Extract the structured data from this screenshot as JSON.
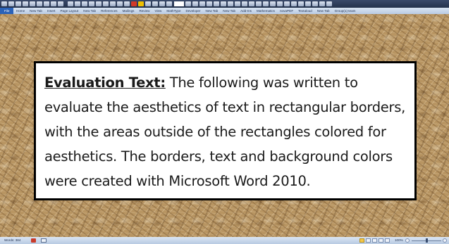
{
  "ribbon": {
    "tabs": [
      "File",
      "Home",
      "New Tab",
      "Insert",
      "Page Layout",
      "New Tab",
      "References",
      "Mailings",
      "Review",
      "View",
      "MathType",
      "Developer",
      "New Tab",
      "New Tab",
      "Add-Ins",
      "Mathematics",
      "novaPDF",
      "Textaloud",
      "New Tab",
      "Group(1) team"
    ]
  },
  "document": {
    "lead": "Evaluation Text:",
    "lines": [
      " The following was written to",
      "evaluate the aesthetics of text in rectangular borders,",
      "with the areas outside of the rectangles colored for",
      "aesthetics.  The borders, text and background colors",
      "were created with Microsoft Word 2010."
    ]
  },
  "status": {
    "words": "Words: 384",
    "zoom": "100%"
  },
  "colors": {
    "box_border": "#000000",
    "box_fill": "#ffffff",
    "background": "#b89562",
    "ribbon_file_tab": "#2a62b8"
  }
}
